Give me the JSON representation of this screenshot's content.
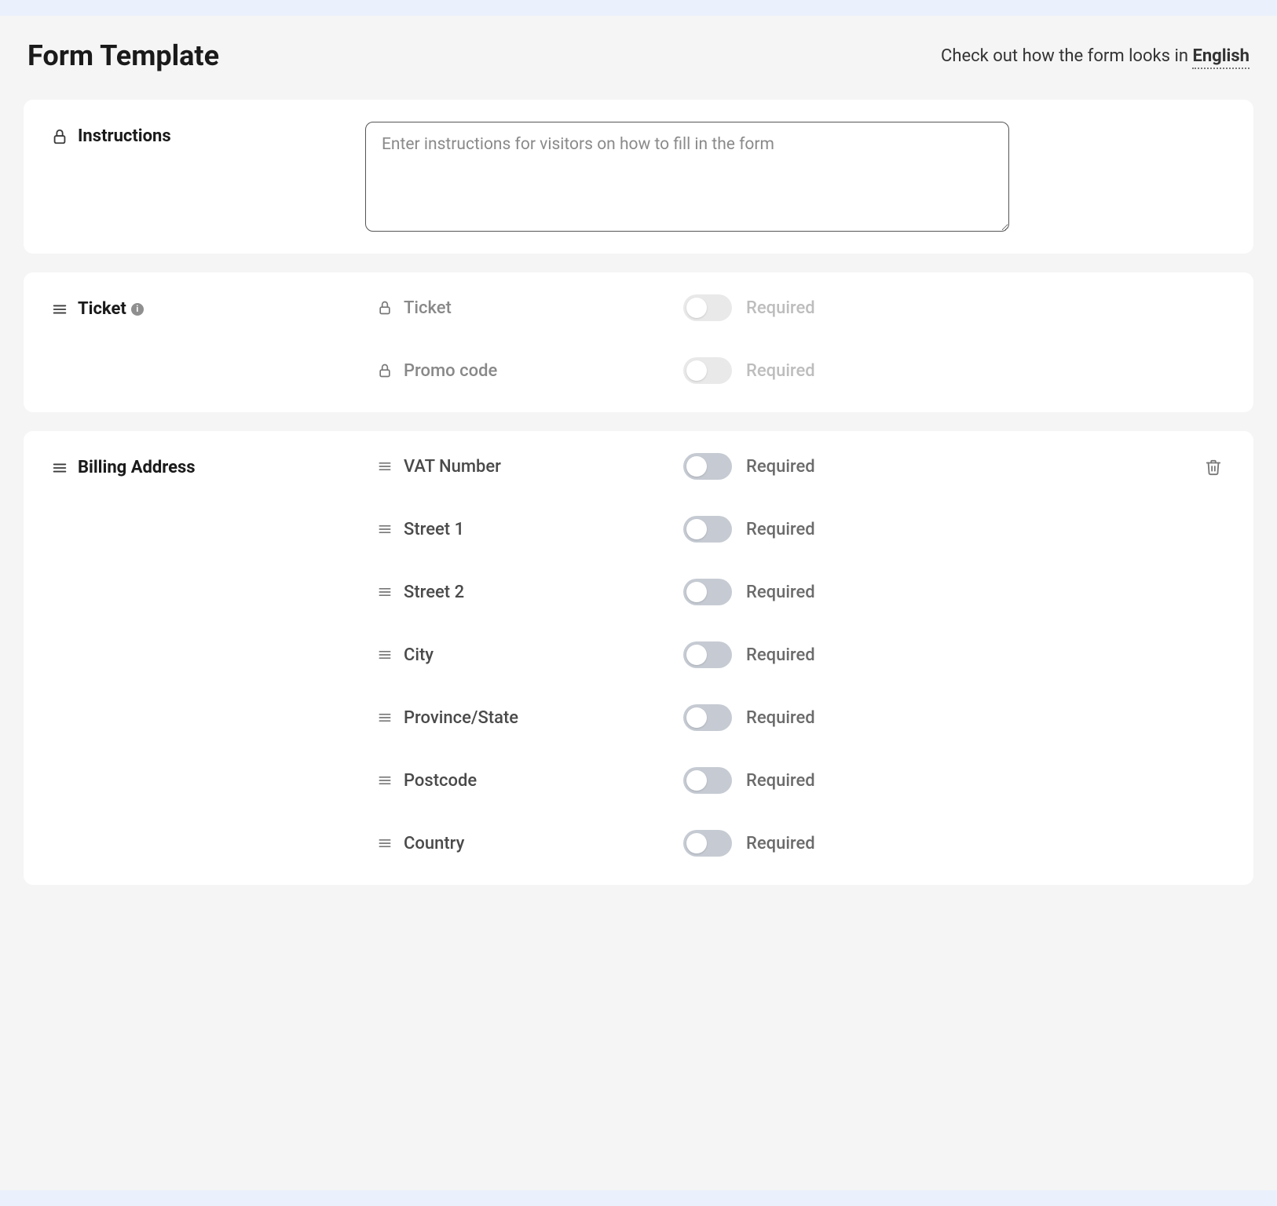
{
  "header": {
    "title": "Form Template",
    "preview_prefix": "Check out how the form looks in ",
    "language": "English"
  },
  "instructions": {
    "label": "Instructions",
    "placeholder": "Enter instructions for visitors on how to fill in the form",
    "value": ""
  },
  "sections": {
    "ticket": {
      "title": "Ticket",
      "fields": [
        {
          "label": "Ticket",
          "locked": true,
          "toggle_disabled": true,
          "toggle_label": "Required"
        },
        {
          "label": "Promo code",
          "locked": true,
          "toggle_disabled": true,
          "toggle_label": "Required"
        }
      ]
    },
    "billing": {
      "title": "Billing Address",
      "deletable": true,
      "fields": [
        {
          "label": "VAT Number",
          "locked": false,
          "toggle_disabled": false,
          "toggle_label": "Required"
        },
        {
          "label": "Street 1",
          "locked": false,
          "toggle_disabled": false,
          "toggle_label": "Required"
        },
        {
          "label": "Street 2",
          "locked": false,
          "toggle_disabled": false,
          "toggle_label": "Required"
        },
        {
          "label": "City",
          "locked": false,
          "toggle_disabled": false,
          "toggle_label": "Required"
        },
        {
          "label": "Province/State",
          "locked": false,
          "toggle_disabled": false,
          "toggle_label": "Required"
        },
        {
          "label": "Postcode",
          "locked": false,
          "toggle_disabled": false,
          "toggle_label": "Required"
        },
        {
          "label": "Country",
          "locked": false,
          "toggle_disabled": false,
          "toggle_label": "Required"
        }
      ]
    }
  }
}
